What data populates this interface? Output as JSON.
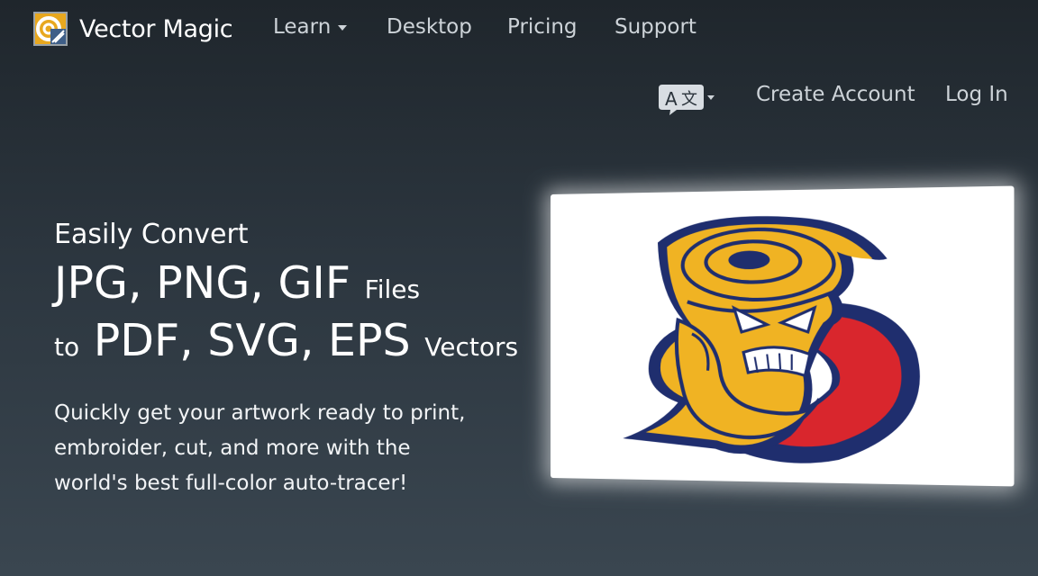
{
  "brand": {
    "name": "Vector Magic"
  },
  "nav": {
    "learn": "Learn",
    "desktop": "Desktop",
    "pricing": "Pricing",
    "support": "Support"
  },
  "account": {
    "create": "Create Account",
    "login": "Log In"
  },
  "hero": {
    "intro": "Easily Convert",
    "formats_in": "JPG, PNG, GIF",
    "files_word": "Files",
    "to_word": "to",
    "formats_out": "PDF, SVG, EPS",
    "vectors_word": "Vectors",
    "description": "Quickly get your artwork ready to print, embroider, cut, and more with the world's best full-color auto-tracer!"
  },
  "colors": {
    "accent_gold": "#f0b323",
    "navy": "#1f2e6e",
    "red": "#d9262d"
  },
  "icons": {
    "logo": "vector-magic-logo-icon",
    "language": "translate-icon",
    "learn_caret": "chevron-down-icon"
  }
}
